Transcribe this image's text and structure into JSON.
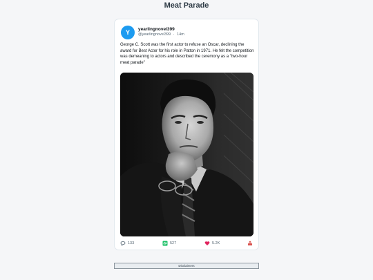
{
  "page": {
    "title": "Meat Parade"
  },
  "tweet": {
    "avatar_initial": "Y",
    "username": "yearlingnovel399",
    "handle": "@yearlingnovel399",
    "separator": "·",
    "time": "14m",
    "text": "George C. Scott was the first actor to refuse an Oscar, declining the award for Best Actor for his role in Patton in 1971. He felt the competition was demeaning to actors and described the ceremony as a \"two-hour meat parade\"",
    "stats": {
      "replies": "133",
      "retweets": "527",
      "likes": "5.2K"
    }
  },
  "footer": {
    "disclaimer_label": "Disclaimers"
  },
  "colors": {
    "avatar": "#1d9bf0",
    "like": "#e0245e",
    "retweet": "#17bf63",
    "reply": "#536471",
    "share": "#d9534f"
  }
}
